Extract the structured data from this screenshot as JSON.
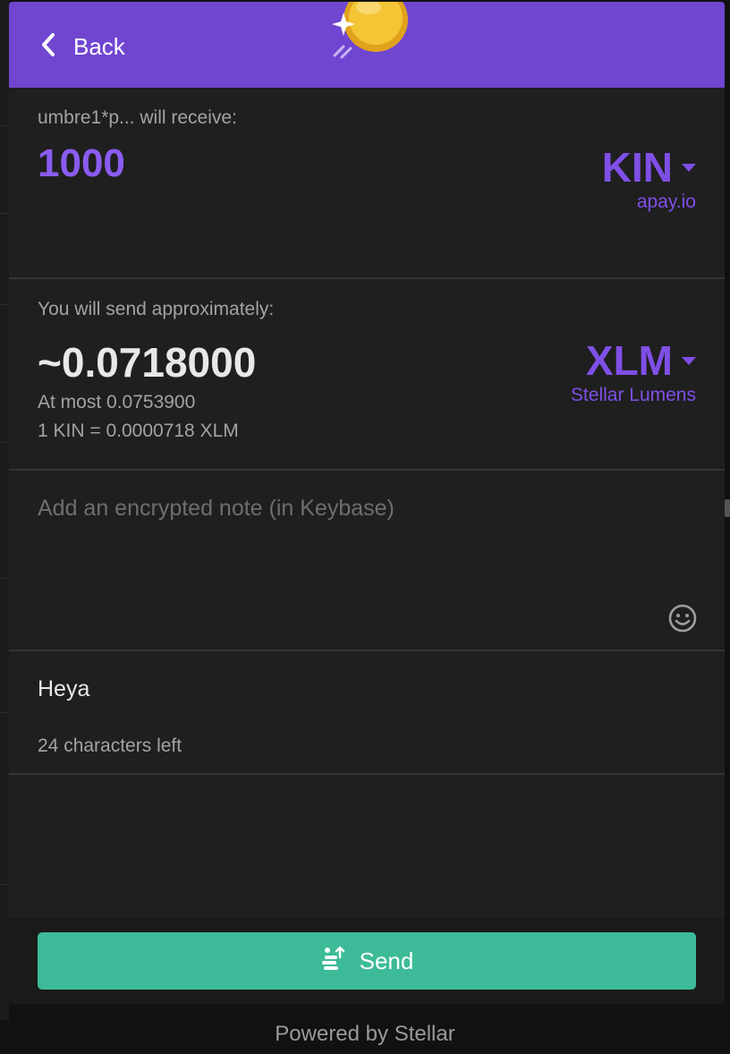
{
  "header": {
    "back_label": "Back"
  },
  "receive": {
    "label": "umbre1*p... will receive:",
    "amount": "1000",
    "currency_code": "KIN",
    "issuer": "apay.io"
  },
  "send": {
    "label": "You will send approximately:",
    "amount": "~0.0718000",
    "at_most": "At most 0.0753900",
    "rate": "1 KIN = 0.0000718 XLM",
    "currency_code": "XLM",
    "currency_name": "Stellar Lumens"
  },
  "note": {
    "placeholder": "Add an encrypted note (in Keybase)",
    "value": ""
  },
  "memo": {
    "value": "Heya",
    "chars_left": "24 characters left"
  },
  "actions": {
    "send_label": "Send"
  },
  "footer": {
    "powered_by": "Powered by Stellar"
  },
  "colors": {
    "header": "#7046d1",
    "accent_purple": "#7f4fe6",
    "send_button": "#3dbb98",
    "panel_bg": "#1f1f1f"
  },
  "icons": {
    "back": "chevron-left-icon",
    "coin": "coin-illustration-icon",
    "emoji": "smiley-icon",
    "send": "coins-send-icon"
  }
}
